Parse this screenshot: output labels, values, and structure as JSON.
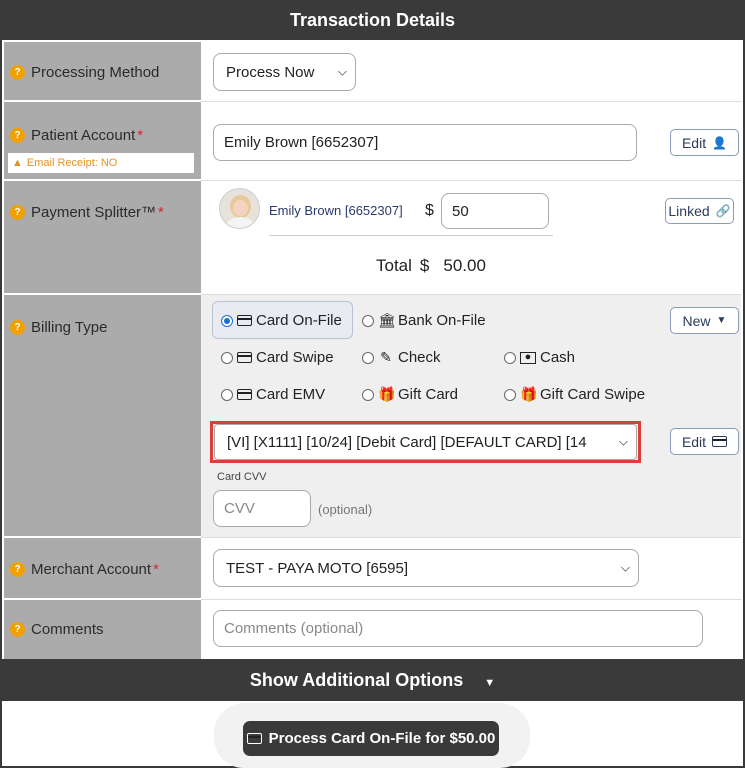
{
  "header": {
    "title": "Transaction Details"
  },
  "processing_method": {
    "label": "Processing Method",
    "help": "?",
    "selected": "Process Now"
  },
  "patient_account": {
    "label": "Patient Account",
    "required": "*",
    "help": "?",
    "email_receipt": "Email Receipt: NO",
    "value": "Emily Brown [6652307]",
    "edit_label": "Edit"
  },
  "payment_splitter": {
    "label": "Payment Splitter™",
    "required": "*",
    "help": "?",
    "patient_name": "Emily Brown [6652307]",
    "currency": "$",
    "amount": "50",
    "linked_label": "Linked",
    "total_label": "Total",
    "total_currency": "$",
    "total_value": "50.00"
  },
  "billing_type": {
    "label": "Billing Type",
    "help": "?",
    "new_label": "New",
    "options": [
      {
        "label": "Card On-File",
        "icon": "credit-card-icon",
        "selected": true
      },
      {
        "label": "Bank On-File",
        "icon": "bank-icon",
        "selected": false
      },
      {
        "label": "Card Swipe",
        "icon": "credit-card-icon",
        "selected": false
      },
      {
        "label": "Check",
        "icon": "pen-icon",
        "selected": false
      },
      {
        "label": "Cash",
        "icon": "cash-icon",
        "selected": false
      },
      {
        "label": "Card EMV",
        "icon": "credit-card-icon",
        "selected": false
      },
      {
        "label": "Gift Card",
        "icon": "gift-icon",
        "selected": false
      },
      {
        "label": "Gift Card Swipe",
        "icon": "gift-icon",
        "selected": false
      }
    ],
    "card_selected": "[VI] [X1111] [10/24] [Debit Card] [DEFAULT CARD] [14",
    "card_edit_label": "Edit",
    "cvv_label": "Card CVV",
    "cvv_placeholder": "CVV",
    "cvv_optional": "(optional)",
    "highlight_color": "#d9403a"
  },
  "merchant_account": {
    "label": "Merchant Account",
    "required": "*",
    "help": "?",
    "selected": "TEST - PAYA MOTO [6595]"
  },
  "comments": {
    "label": "Comments",
    "help": "?",
    "placeholder": "Comments (optional)"
  },
  "additional_options": {
    "label": "Show Additional Options"
  },
  "process_button": {
    "label": "Process Card On-File for $50.00"
  }
}
